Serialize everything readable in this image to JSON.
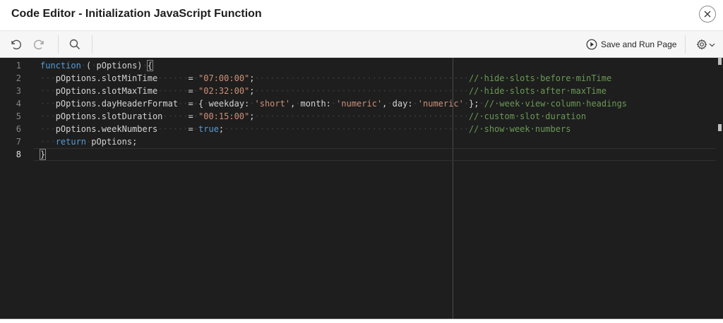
{
  "dialog": {
    "title": "Code Editor - Initialization JavaScript Function"
  },
  "toolbar": {
    "undo_icon": "undo-icon",
    "redo_icon": "redo-icon",
    "search_icon": "search-icon",
    "save_run_label": "Save and Run Page",
    "settings_icon": "gear-icon"
  },
  "editor": {
    "active_line": 8,
    "line_numbers": [
      "1",
      "2",
      "3",
      "4",
      "5",
      "6",
      "7",
      "8"
    ],
    "lines": [
      [
        {
          "t": "kw",
          "v": "function"
        },
        {
          "t": "dots",
          "v": "·"
        },
        {
          "t": "plain",
          "v": "("
        },
        {
          "t": "dots",
          "v": "·"
        },
        {
          "t": "plain",
          "v": "pOptions)"
        },
        {
          "t": "dots",
          "v": "·"
        },
        {
          "t": "brace",
          "v": "{"
        }
      ],
      [
        {
          "t": "dots",
          "v": "···"
        },
        {
          "t": "plain",
          "v": "pOptions.slotMinTime"
        },
        {
          "t": "dots",
          "v": "······"
        },
        {
          "t": "plain",
          "v": "="
        },
        {
          "t": "dots",
          "v": "·"
        },
        {
          "t": "str",
          "v": "\"07:00:00\""
        },
        {
          "t": "plain",
          "v": ";"
        },
        {
          "t": "dots",
          "v": "··········································"
        },
        {
          "t": "cmt",
          "v": "//·hide·slots·before·minTime"
        }
      ],
      [
        {
          "t": "dots",
          "v": "···"
        },
        {
          "t": "plain",
          "v": "pOptions.slotMaxTime"
        },
        {
          "t": "dots",
          "v": "······"
        },
        {
          "t": "plain",
          "v": "="
        },
        {
          "t": "dots",
          "v": "·"
        },
        {
          "t": "str",
          "v": "\"02:32:00\""
        },
        {
          "t": "plain",
          "v": ";"
        },
        {
          "t": "dots",
          "v": "··········································"
        },
        {
          "t": "cmt",
          "v": "//·hide·slots·after·maxTime"
        }
      ],
      [
        {
          "t": "dots",
          "v": "···"
        },
        {
          "t": "plain",
          "v": "pOptions.dayHeaderFormat"
        },
        {
          "t": "dots",
          "v": "··"
        },
        {
          "t": "plain",
          "v": "="
        },
        {
          "t": "dots",
          "v": "·"
        },
        {
          "t": "plain",
          "v": "{"
        },
        {
          "t": "dots",
          "v": "·"
        },
        {
          "t": "plain",
          "v": "weekday:"
        },
        {
          "t": "dots",
          "v": "·"
        },
        {
          "t": "str",
          "v": "'short'"
        },
        {
          "t": "plain",
          "v": ","
        },
        {
          "t": "dots",
          "v": "·"
        },
        {
          "t": "plain",
          "v": "month:"
        },
        {
          "t": "dots",
          "v": "·"
        },
        {
          "t": "str",
          "v": "'numeric'"
        },
        {
          "t": "plain",
          "v": ","
        },
        {
          "t": "dots",
          "v": "·"
        },
        {
          "t": "plain",
          "v": "day:"
        },
        {
          "t": "dots",
          "v": "·"
        },
        {
          "t": "str",
          "v": "'numeric'"
        },
        {
          "t": "dots",
          "v": "·"
        },
        {
          "t": "plain",
          "v": "};"
        },
        {
          "t": "dots",
          "v": "·"
        },
        {
          "t": "cmt",
          "v": "//·week·view·column·headings"
        }
      ],
      [
        {
          "t": "dots",
          "v": "···"
        },
        {
          "t": "plain",
          "v": "pOptions.slotDuration"
        },
        {
          "t": "dots",
          "v": "·····"
        },
        {
          "t": "plain",
          "v": "="
        },
        {
          "t": "dots",
          "v": "·"
        },
        {
          "t": "str",
          "v": "\"00:15:00\""
        },
        {
          "t": "plain",
          "v": ";"
        },
        {
          "t": "dots",
          "v": "··········································"
        },
        {
          "t": "cmt",
          "v": "//·custom·slot·duration"
        }
      ],
      [
        {
          "t": "dots",
          "v": "···"
        },
        {
          "t": "plain",
          "v": "pOptions.weekNumbers"
        },
        {
          "t": "dots",
          "v": "······"
        },
        {
          "t": "plain",
          "v": "="
        },
        {
          "t": "dots",
          "v": "·"
        },
        {
          "t": "kw",
          "v": "true"
        },
        {
          "t": "plain",
          "v": ";"
        },
        {
          "t": "dots",
          "v": "················································"
        },
        {
          "t": "cmt",
          "v": "//·show·week·numbers"
        }
      ],
      [
        {
          "t": "dots",
          "v": "···"
        },
        {
          "t": "kw",
          "v": "return"
        },
        {
          "t": "dots",
          "v": "·"
        },
        {
          "t": "plain",
          "v": "pOptions;"
        }
      ],
      [
        {
          "t": "brace",
          "v": "}"
        }
      ]
    ]
  }
}
